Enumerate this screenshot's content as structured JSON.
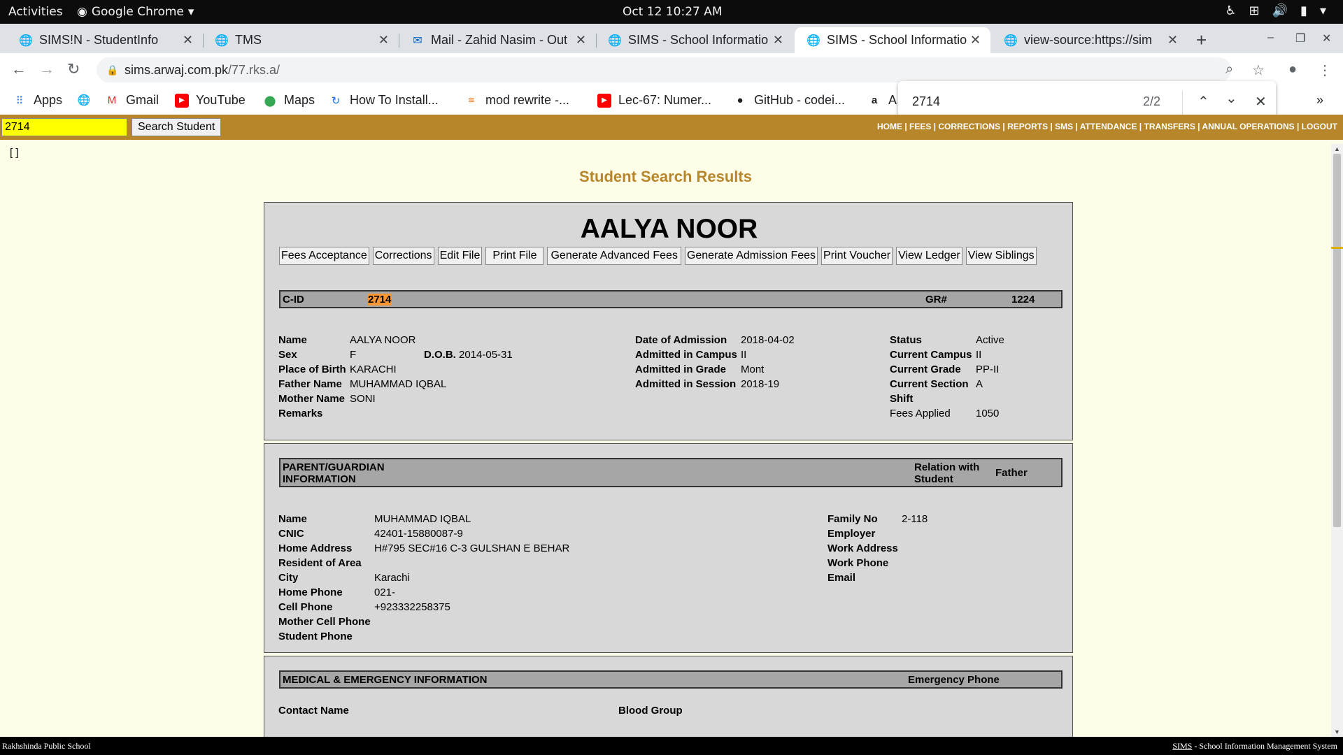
{
  "topbar": {
    "activities": "Activities",
    "app_name": "Google Chrome",
    "clock": "Oct 12  10:27 AM"
  },
  "tabs": [
    {
      "title": "SIMS!N - StudentInfo"
    },
    {
      "title": "TMS"
    },
    {
      "title": "Mail - Zahid Nasim - Out"
    },
    {
      "title": "SIMS - School Informatio"
    },
    {
      "title": "SIMS - School Informatio",
      "active": true
    },
    {
      "title": "view-source:https://sim"
    }
  ],
  "address": {
    "domain": "sims.arwaj.com.pk",
    "path": "/77.rks.a/"
  },
  "bookmarks": [
    "Apps",
    "Gmail",
    "YouTube",
    "Maps",
    "How To Install...",
    "mod rewrite -...",
    "Lec-67: Numer...",
    "GitHub - codei...",
    "A"
  ],
  "find": {
    "query": "2714",
    "count": "2/2"
  },
  "search": {
    "value": "2714",
    "button": "Search Student"
  },
  "topnav": "HOME | FEES | CORRECTIONS | REPORTS | SMS | ATTENDANCE | TRANSFERS | ANNUAL OPERATIONS | LOGOUT",
  "bracket": "[ ]",
  "heading": "Student Search Results",
  "student": {
    "name_title": "AALYA NOOR",
    "buttons": [
      "Fees Acceptance",
      "Corrections",
      "Edit File",
      "Print File",
      "Generate Advanced Fees",
      "Generate Admission Fees",
      "Print Voucher",
      "View Ledger",
      "View Siblings"
    ],
    "cid_label": "C-ID",
    "cid": "2714",
    "gr_label": "GR#",
    "gr": "1224",
    "labels": {
      "name": "Name",
      "sex": "Sex",
      "dob": "D.O.B.",
      "place_of_birth": "Place of Birth",
      "father": "Father Name",
      "mother": "Mother Name",
      "remarks": "Remarks",
      "doa": "Date of Admission",
      "adm_campus": "Admitted in Campus",
      "adm_grade": "Admitted in Grade",
      "adm_session": "Admitted in Session",
      "status": "Status",
      "cur_campus": "Current Campus",
      "cur_grade": "Current Grade",
      "cur_section": "Current Section",
      "shift": "Shift",
      "fees_applied": "Fees Applied"
    },
    "values": {
      "name": "AALYA NOOR",
      "sex": "F",
      "dob": "2014-05-31",
      "place_of_birth": "KARACHI",
      "father": "MUHAMMAD IQBAL",
      "mother": "SONI",
      "doa": "2018-04-02",
      "adm_campus": "II",
      "adm_grade": "Mont",
      "adm_session": "2018-19",
      "status": "Active",
      "cur_campus": "II",
      "cur_grade": "PP-II",
      "cur_section": "A",
      "fees_applied": "1050"
    }
  },
  "guardian": {
    "header": "PARENT/GUARDIAN INFORMATION",
    "header_line1": "PARENT/GUARDIAN",
    "header_line2": "INFORMATION",
    "relation_label_1": "Relation with",
    "relation_label_2": "Student",
    "relation": "Father",
    "labels": {
      "name": "Name",
      "cnic": "CNIC",
      "home_address": "Home Address",
      "resident_area": "Resident of Area",
      "city": "City",
      "home_phone": "Home Phone",
      "cell_phone": "Cell Phone",
      "mother_cell": "Mother Cell Phone",
      "student_phone": "Student Phone",
      "family_no": "Family No",
      "employer": "Employer",
      "work_address": "Work Address",
      "work_phone": "Work Phone",
      "email": "Email"
    },
    "values": {
      "name": "MUHAMMAD IQBAL",
      "cnic": "42401-15880087-9",
      "home_address": "H#795 SEC#16 C-3 GULSHAN E BEHAR",
      "city": "Karachi",
      "home_phone": "021-",
      "cell_phone": "+923332258375",
      "family_no": "2-118"
    }
  },
  "medical": {
    "header": "MEDICAL & EMERGENCY INFORMATION",
    "emergency_phone": "Emergency Phone",
    "contact_name": "Contact Name",
    "blood_group": "Blood Group"
  },
  "footer": {
    "left": "Rakhshinda Public School",
    "right_link": "SIMS",
    "right_text": " - School Information Management System"
  },
  "colors": {
    "accent_bar": "#b8862a",
    "page_bg": "#fefee8",
    "panel_bg": "#d8d8d8",
    "find_highlight": "#ff9632"
  }
}
